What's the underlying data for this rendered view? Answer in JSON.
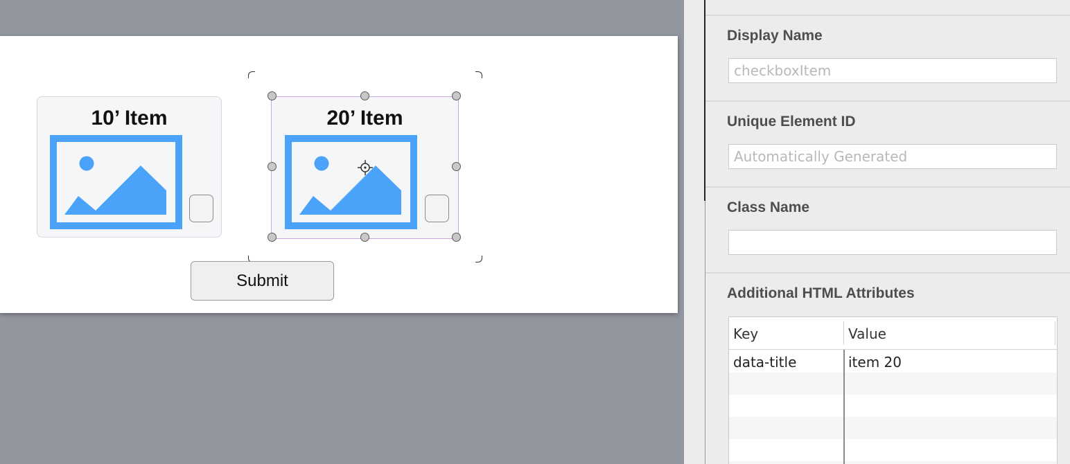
{
  "canvas": {
    "cards": [
      {
        "title": "10’ Item",
        "image": "image-placeholder-icon"
      },
      {
        "title": "20’ Item",
        "image": "image-placeholder-icon",
        "selected": true
      }
    ],
    "submit_label": "Submit"
  },
  "colors": {
    "canvas_bg": "#92969f",
    "image_icon": "#4aa3f8",
    "selection_outline": "#c9a6de",
    "panel_bg": "#ececec"
  },
  "inspector": {
    "display_name": {
      "label": "Display Name",
      "placeholder": "checkboxItem",
      "value": ""
    },
    "unique_id": {
      "label": "Unique Element ID",
      "placeholder": "Automatically Generated",
      "value": ""
    },
    "class_name": {
      "label": "Class Name",
      "placeholder": "",
      "value": ""
    },
    "attributes": {
      "label": "Additional HTML Attributes",
      "columns": [
        "Key",
        "Value"
      ],
      "rows": [
        {
          "key": "data-title",
          "value": "item 20"
        }
      ]
    }
  }
}
